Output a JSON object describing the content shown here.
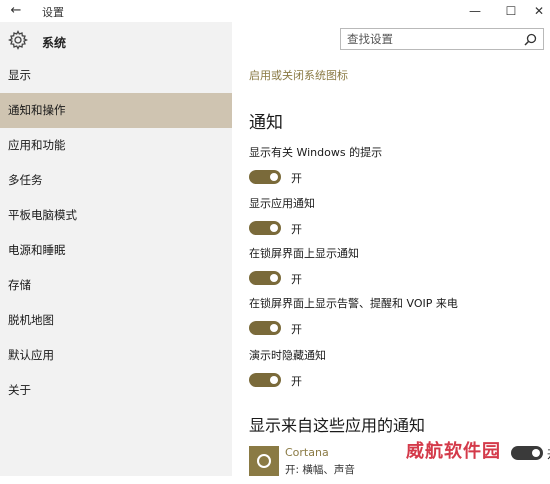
{
  "window": {
    "title": "设置",
    "minimize_glyph": "—",
    "maximize_glyph": "☐",
    "close_glyph": "✕",
    "back_glyph": "←"
  },
  "sidebar": {
    "header": "系统",
    "items": [
      {
        "label": "显示",
        "active": false
      },
      {
        "label": "通知和操作",
        "active": true
      },
      {
        "label": "应用和功能",
        "active": false
      },
      {
        "label": "多任务",
        "active": false
      },
      {
        "label": "平板电脑模式",
        "active": false
      },
      {
        "label": "电源和睡眠",
        "active": false
      },
      {
        "label": "存储",
        "active": false
      },
      {
        "label": "脱机地图",
        "active": false
      },
      {
        "label": "默认应用",
        "active": false
      },
      {
        "label": "关于",
        "active": false
      }
    ]
  },
  "search": {
    "placeholder": "查找设置"
  },
  "main": {
    "link": "启用或关闭系统图标",
    "notifications_heading": "通知",
    "settings": [
      {
        "label": "显示有关 Windows 的提示",
        "state": "开",
        "on": true
      },
      {
        "label": "显示应用通知",
        "state": "开",
        "on": true
      },
      {
        "label": "在锁屏界面上显示通知",
        "state": "开",
        "on": true
      },
      {
        "label": "在锁屏界面上显示告警、提醒和 VOIP 来电",
        "state": "开",
        "on": true
      },
      {
        "label": "演示时隐藏通知",
        "state": "开",
        "on": true
      }
    ],
    "apps_heading": "显示来自这些应用的通知",
    "apps": [
      {
        "name": "Cortana",
        "detail": "开: 横幅、声音",
        "state": "开",
        "on": true
      }
    ]
  },
  "watermark": "威航软件园",
  "colors": {
    "accent": "#7a6a3a",
    "link": "#8a7a44",
    "sidebar_bg": "#f2f2f2",
    "sidebar_active": "#cfc4b1"
  }
}
